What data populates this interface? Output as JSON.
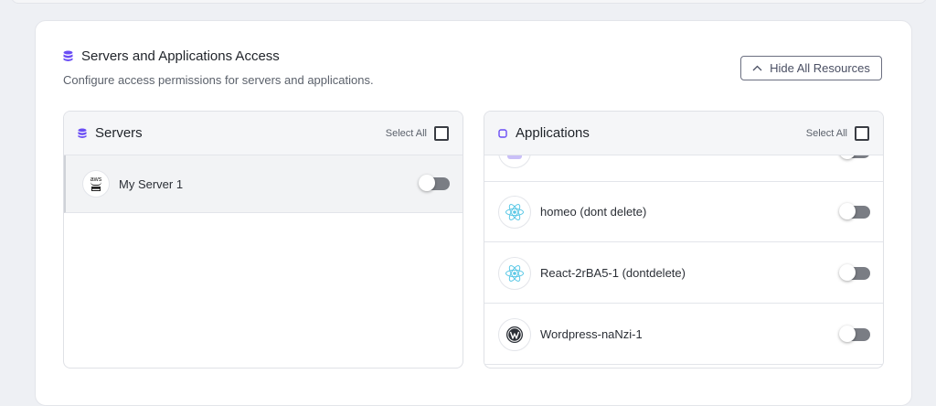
{
  "section": {
    "title": "Servers and Applications Access",
    "subtitle": "Configure access permissions for servers and applications.",
    "hide_button": "Hide All Resources"
  },
  "servers": {
    "title": "Servers",
    "select_all": "Select All",
    "items": [
      {
        "name": "My Server 1",
        "enabled": false,
        "icon": "aws-icon",
        "logo_text": "aws"
      }
    ]
  },
  "applications": {
    "title": "Applications",
    "select_all": "Select All",
    "items": [
      {
        "name": "",
        "enabled": false,
        "icon": "app-icon"
      },
      {
        "name": "homeo (dont delete)",
        "enabled": false,
        "icon": "react-icon"
      },
      {
        "name": "React-2rBA5-1 (dontdelete)",
        "enabled": false,
        "icon": "react-icon"
      },
      {
        "name": "Wordpress-naNzi-1",
        "enabled": false,
        "icon": "wordpress-icon"
      }
    ]
  },
  "colors": {
    "accent": "#6a4df5",
    "toggle_off": "#7a7d84",
    "react": "#5ac8e6"
  }
}
